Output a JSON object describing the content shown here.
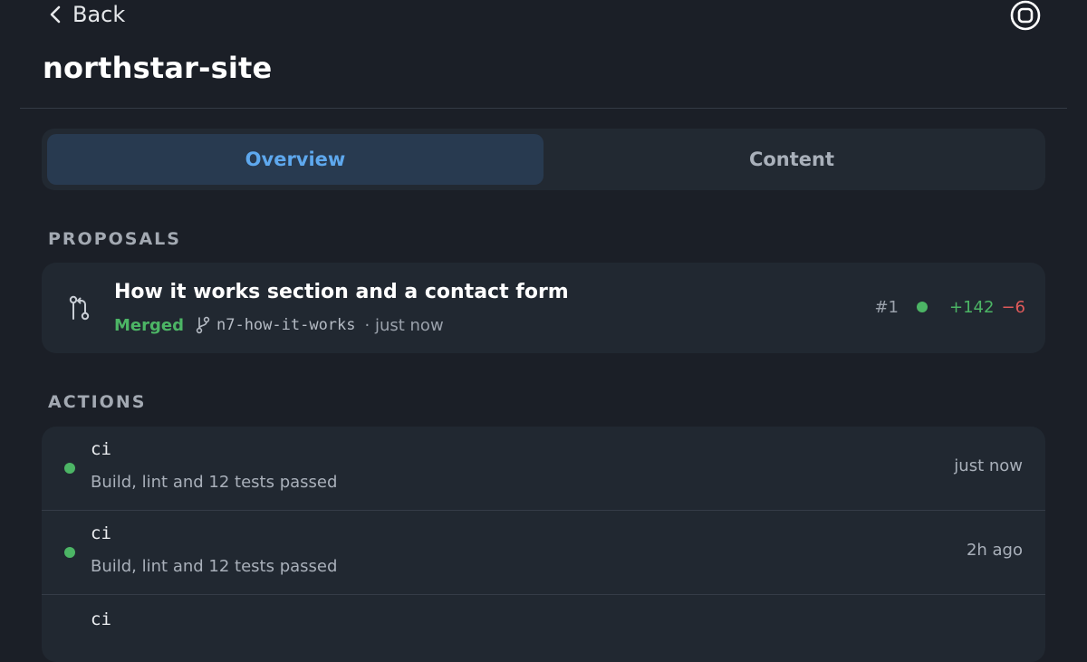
{
  "header": {
    "back_label": "Back",
    "title": "northstar-site"
  },
  "tabs": [
    {
      "label": "Overview",
      "active": true
    },
    {
      "label": "Content",
      "active": false
    }
  ],
  "proposals": {
    "section_label": "PROPOSALS",
    "items": [
      {
        "title": "How it works section and a contact form",
        "status": "Merged",
        "branch": "n7-how-it-works",
        "time": "· just now",
        "number": "#1",
        "additions": "+142",
        "deletions": "−6"
      }
    ]
  },
  "actions": {
    "section_label": "ACTIONS",
    "items": [
      {
        "name": "ci",
        "description": "Build, lint and 12 tests passed",
        "time": "just now"
      },
      {
        "name": "ci",
        "description": "Build, lint and 12 tests passed",
        "time": "2h ago"
      },
      {
        "name": "ci",
        "description": "",
        "time": ""
      }
    ]
  },
  "colors": {
    "background": "#1b1f27",
    "accent": "#5ea8ee",
    "success": "#4cb565",
    "danger": "#e05a5a"
  },
  "icons": {
    "back": "chevron-left-icon",
    "settings": "circle-settings-icon",
    "proposal": "pull-request-icon",
    "branch": "branch-icon"
  }
}
